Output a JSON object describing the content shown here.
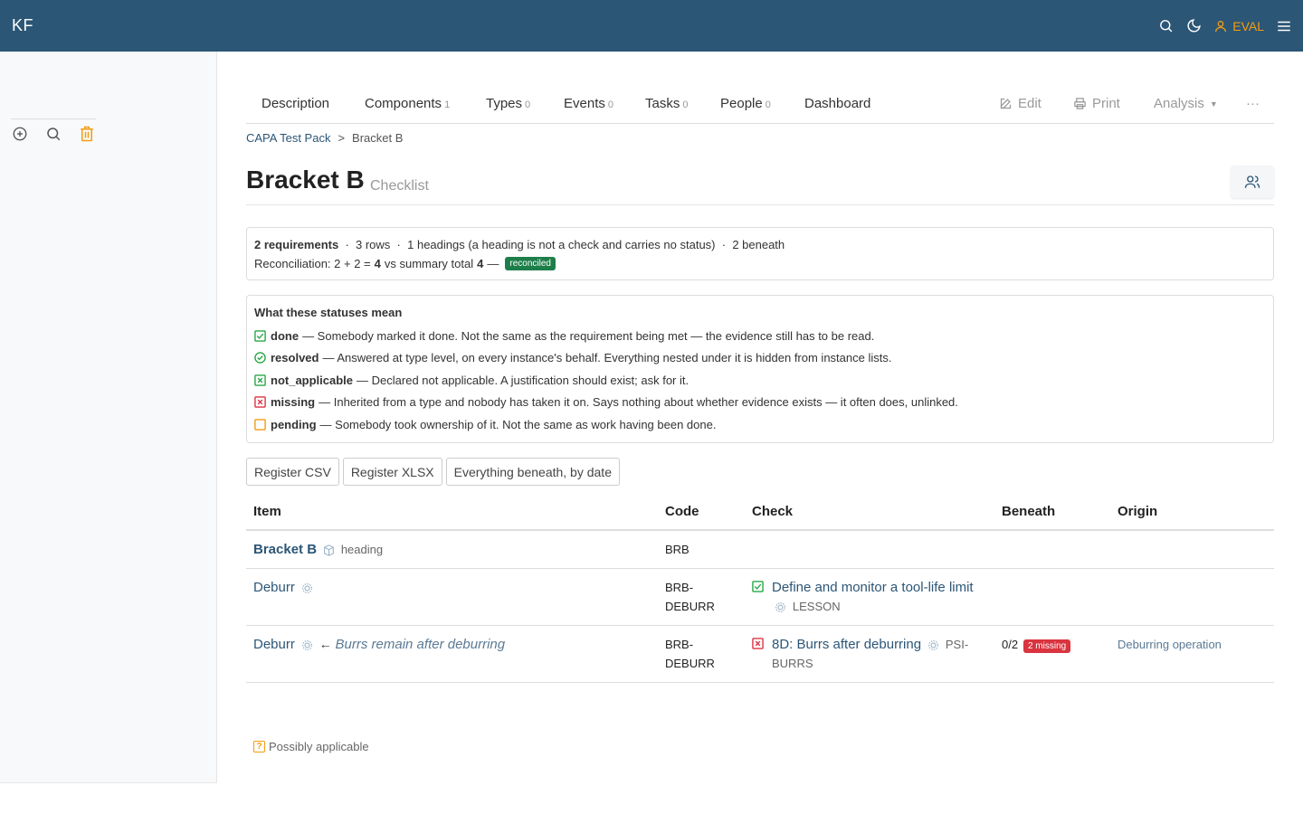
{
  "app": {
    "brand": "KF",
    "user": "EVAL"
  },
  "tabs": [
    {
      "label": "Description",
      "count": ""
    },
    {
      "label": "Components",
      "count": "1"
    },
    {
      "label": "Types",
      "count": "0"
    },
    {
      "label": "Events",
      "count": "0"
    },
    {
      "label": "Tasks",
      "count": "0"
    },
    {
      "label": "People",
      "count": "0"
    },
    {
      "label": "Dashboard",
      "count": ""
    }
  ],
  "actions": {
    "edit": "Edit",
    "print": "Print",
    "analysis": "Analysis",
    "more": "···"
  },
  "breadcrumb": {
    "parent": "CAPA Test Pack",
    "sep": ">",
    "current": "Bracket B"
  },
  "page": {
    "title": "Bracket B",
    "subtitle": "Checklist"
  },
  "summary": {
    "requirements": "2 requirements",
    "rows": "3 rows",
    "headings": "1 headings (a heading is not a check and carries no status)",
    "beneath": "2 beneath",
    "dot": "·",
    "recon_prefix": "Reconciliation: 2 + 2 =",
    "recon_value": "4",
    "recon_mid": "vs summary total",
    "recon_total": "4",
    "recon_dash": "—",
    "recon_badge": "reconciled"
  },
  "legend": {
    "title": "What these statuses mean",
    "items": [
      {
        "status": "done",
        "text": "— Somebody marked it done. Not the same as the requirement being met — the evidence still has to be read.",
        "icon": "check-square",
        "color": "#28a745"
      },
      {
        "status": "resolved",
        "text": "— Answered at type level, on every instance's behalf. Everything nested under it is hidden from instance lists.",
        "icon": "check-circle",
        "color": "#28a745"
      },
      {
        "status": "not_applicable",
        "text": "— Declared not applicable. A justification should exist; ask for it.",
        "icon": "x-square",
        "color": "#28a745"
      },
      {
        "status": "missing",
        "text": "— Inherited from a type and nobody has taken it on. Says nothing about whether evidence exists — it often does, unlinked.",
        "icon": "x-square",
        "color": "#dc3545"
      },
      {
        "status": "pending",
        "text": "— Somebody took ownership of it. Not the same as work having been done.",
        "icon": "square",
        "color": "#f39c12"
      }
    ]
  },
  "buttons": {
    "csv": "Register CSV",
    "xlsx": "Register XLSX",
    "beneath": "Everything beneath, by date"
  },
  "table": {
    "headers": {
      "item": "Item",
      "code": "Code",
      "check": "Check",
      "beneath": "Beneath",
      "origin": "Origin"
    },
    "rows": [
      {
        "item": "Bracket B",
        "item_tag": "heading",
        "code": "BRB"
      },
      {
        "item": "Deburr",
        "code1": "BRB-",
        "code2": "DEBURR",
        "check": "Define and monitor a tool-life limit",
        "check_tag": "LESSON"
      },
      {
        "item": "Deburr",
        "arrow": "←",
        "item_note": "Burrs remain after deburring",
        "code1": "BRB-",
        "code2": "DEBURR",
        "check": "8D: Burrs after deburring",
        "check_tag1": "PSI-",
        "check_tag2": "BURRS",
        "beneath": "0/2",
        "beneath_badge": "2 missing",
        "origin": "Deburring operation"
      }
    ]
  },
  "footnote": {
    "text": "Possibly applicable",
    "icon_glyph": "?"
  },
  "colors": {
    "topbar": "#2c5676",
    "accent": "#f39c12",
    "ok": "#1e7e4a",
    "danger": "#d9343f"
  }
}
